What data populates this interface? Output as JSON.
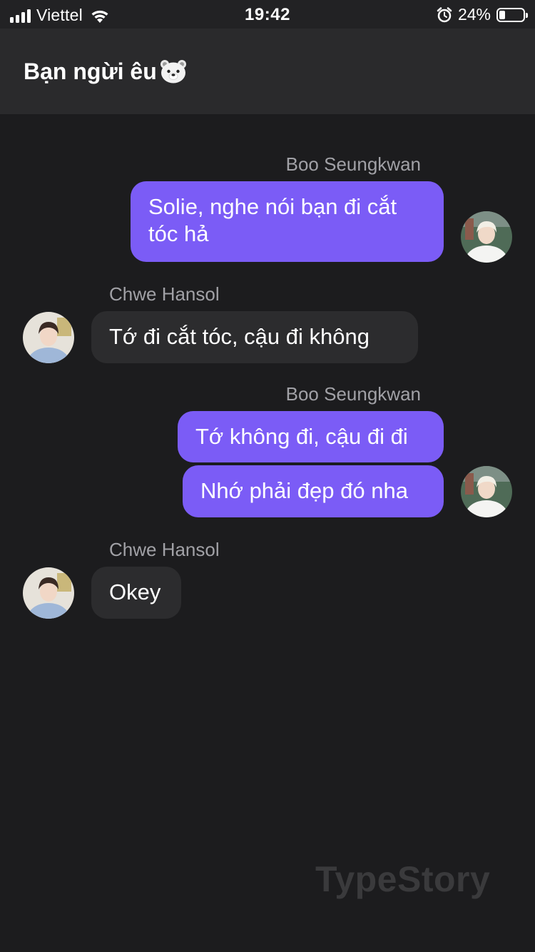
{
  "status_bar": {
    "carrier": "Viettel",
    "time": "19:42",
    "battery_percent": "24%",
    "battery_level": 0.24,
    "icons": [
      "signal-icon",
      "wifi-icon",
      "alarm-icon",
      "battery-icon"
    ]
  },
  "header": {
    "title": "Bạn ngừi êu",
    "title_emoji_icon": "polar-bear-icon"
  },
  "colors": {
    "background": "#1c1c1e",
    "header": "#2a2a2c",
    "outgoing_bubble": "#7b5cf6",
    "incoming_bubble": "#2c2c2e",
    "sender_name": "#a1a1a6"
  },
  "messages": [
    {
      "sender": "Boo Seungkwan",
      "side": "right",
      "texts": [
        "Solie, nghe nói bạn đi cắt tóc hả"
      ]
    },
    {
      "sender": "Chwe Hansol",
      "side": "left",
      "texts": [
        "Tớ đi cắt tóc, cậu đi không"
      ]
    },
    {
      "sender": "Boo Seungkwan",
      "side": "right",
      "texts": [
        "Tớ không đi, cậu đi đi",
        "Nhớ phải đẹp đó nha"
      ]
    },
    {
      "sender": "Chwe Hansol",
      "side": "left",
      "texts": [
        "Okey"
      ]
    }
  ],
  "watermark": "TypeStory"
}
